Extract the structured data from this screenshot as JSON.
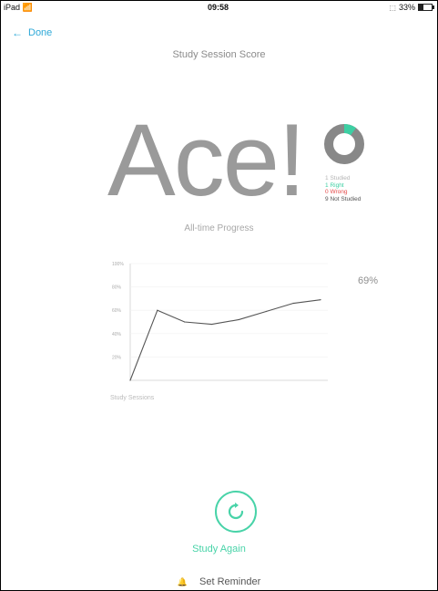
{
  "status_bar": {
    "device": "iPad",
    "wifi_icon": "wifi-icon",
    "time": "09:58",
    "bluetooth_icon": "bluetooth-icon",
    "battery": "33%",
    "battery_level": 0.33
  },
  "nav": {
    "back_icon": "arrow-left-icon",
    "back_label": "Done"
  },
  "header": {
    "title": "Study Session Score"
  },
  "result": {
    "score_text": "Ace!"
  },
  "summary": {
    "donut": {
      "right_color": "#3dcfa3",
      "rest_color": "#888888",
      "right_fraction": 0.1
    },
    "legend": [
      {
        "count": "1",
        "label": "Studied",
        "color": "#b5b5b5"
      },
      {
        "count": "1",
        "label": "Right",
        "color": "#3dcfa3"
      },
      {
        "count": "0",
        "label": "Wrong",
        "color": "#e44a4a"
      },
      {
        "count": "9",
        "label": "Not Studied",
        "color": "#555555"
      }
    ]
  },
  "progress": {
    "title": "All-time Progress",
    "current_percent": "69%",
    "x_axis_label": "Study Sessions"
  },
  "chart_data": {
    "type": "line",
    "title": "All-time Progress",
    "xlabel": "Study Sessions",
    "ylabel": "",
    "y_ticks": [
      "100%",
      "80%",
      "60%",
      "40%",
      "20%"
    ],
    "ylim": [
      0,
      100
    ],
    "grid": true,
    "x": [
      0,
      1,
      2,
      3,
      4,
      5,
      6,
      7
    ],
    "series": [
      {
        "values": [
          0,
          60,
          50,
          48,
          52,
          59,
          66,
          69
        ]
      }
    ]
  },
  "actions": {
    "study_again_icon": "refresh-icon",
    "study_again_label": "Study Again",
    "reminder_icon": "bell-icon",
    "reminder_label": "Set Reminder"
  }
}
